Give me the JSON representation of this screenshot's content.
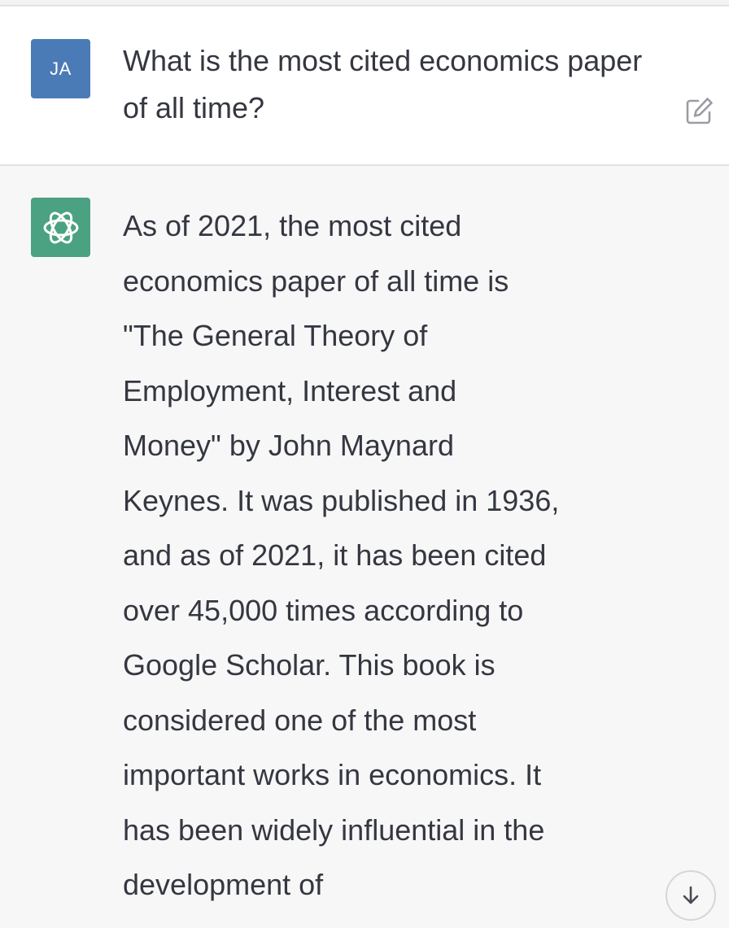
{
  "user_message": {
    "avatar_initials": "JA",
    "avatar_color": "#4a7bb6",
    "text": "What is the most cited economics paper of all time?",
    "edit_icon": "edit-icon"
  },
  "assistant_message": {
    "avatar_icon": "openai-logo-icon",
    "avatar_color": "#4aa282",
    "lines": [
      "As of 2021, the most cited",
      "economics paper of all time is",
      "\"The General Theory of",
      "Employment, Interest and",
      "Money\" by John Maynard",
      "Keynes. It was published in 1936,",
      "and as of 2021, it has been cited",
      "over 45,000 times according to",
      "Google Scholar. This book is",
      "considered one of the most",
      "important works in economics. It",
      "has been widely influential in the",
      "development of"
    ]
  },
  "scroll_down_icon": "arrow-down-icon"
}
